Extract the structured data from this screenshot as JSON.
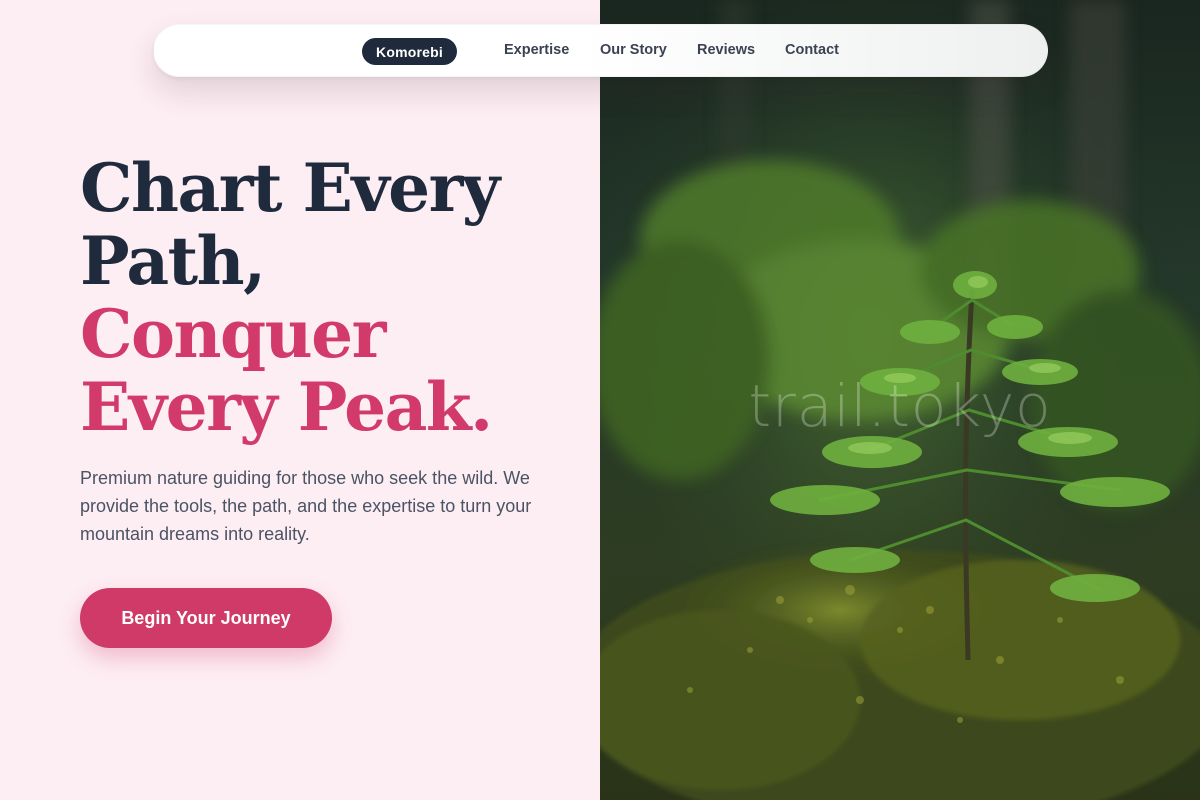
{
  "nav": {
    "brand": "Komorebi",
    "links": [
      "Expertise",
      "Our Story",
      "Reviews",
      "Contact"
    ]
  },
  "hero": {
    "headline_dark_line1": "Chart Every",
    "headline_dark_line2": "Path,",
    "headline_accent_line1": "Conquer",
    "headline_accent_line2": "Every Peak.",
    "subtext": "Premium nature guiding for those who seek the wild. We provide the tools, the path, and the expertise to turn your mountain dreams into reality.",
    "cta_label": "Begin Your Journey"
  },
  "image": {
    "watermark": "trail.tokyo",
    "subject": "young conifer sapling on mossy forest floor"
  },
  "colors": {
    "page_background": "#fdeef3",
    "headline_dark": "#1f2a3d",
    "accent": "#d23a6b",
    "brand_pill": "#1f2a3d",
    "body_text": "#4b5364"
  }
}
